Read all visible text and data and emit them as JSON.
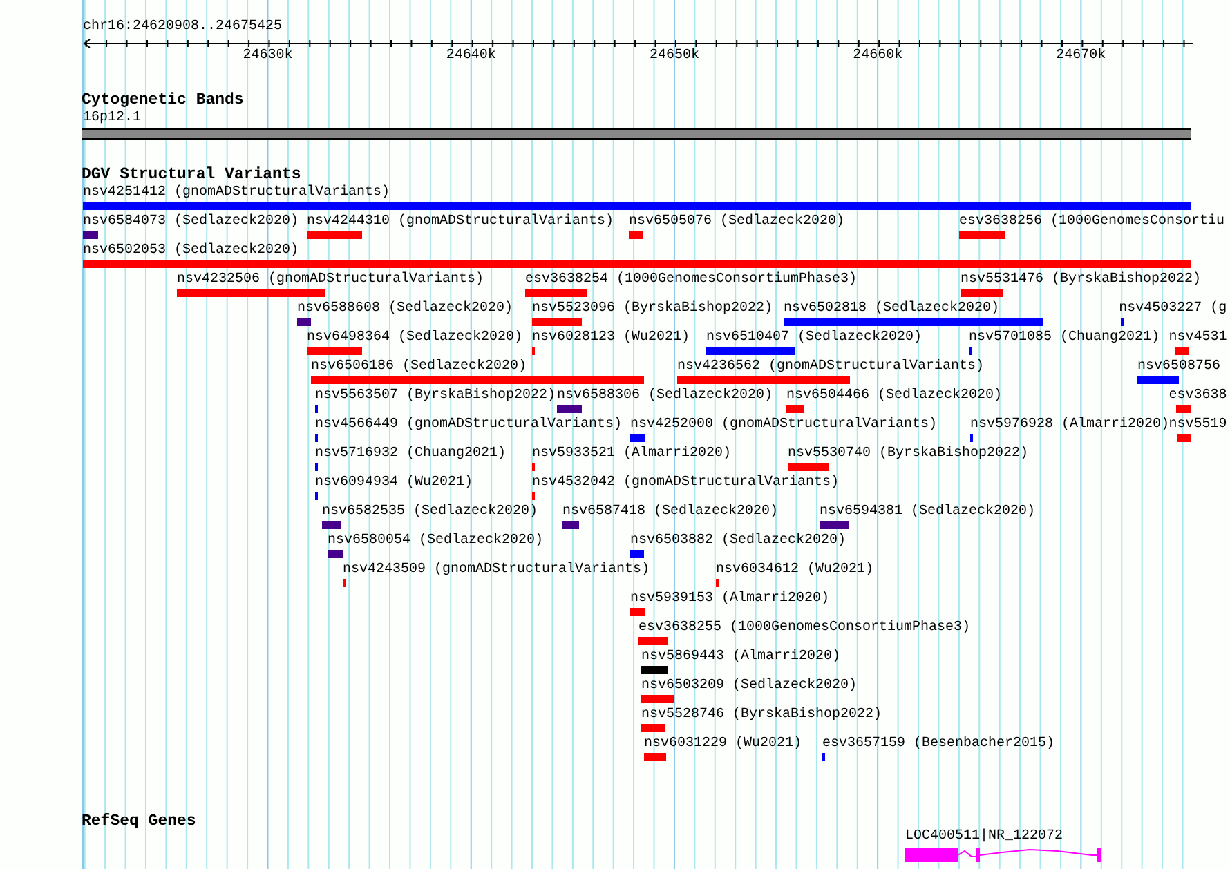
{
  "ruler": {
    "range": "chr16:24620908..24675425",
    "ticks": [
      "24630k",
      "24640k",
      "24650k",
      "24660k",
      "24670k"
    ]
  },
  "cytoband_track": {
    "title": "Cytogenetic Bands",
    "band": "16p12.1"
  },
  "dgv_track": {
    "title": "DGV Structural Variants",
    "rows": [
      {
        "features": [
          {
            "label": "nsv4251412 (gnomADStructuralVariants)",
            "color": "#0000ff"
          }
        ]
      },
      {
        "features": [
          {
            "label": "nsv6584073 (Sedlazeck2020)",
            "color": "#46008c"
          },
          {
            "label": "nsv4244310 (gnomADStructuralVariants)",
            "color": "#ff0000"
          },
          {
            "label": "nsv6505076 (Sedlazeck2020)",
            "color": "#ff0000"
          },
          {
            "label": "esv3638256 (1000GenomesConsortiu",
            "color": "#ff0000"
          }
        ]
      },
      {
        "features": [
          {
            "label": "nsv6502053 (Sedlazeck2020)",
            "color": "#ff0000"
          }
        ]
      },
      {
        "features": [
          {
            "label": "nsv4232506 (gnomADStructuralVariants)",
            "color": "#ff0000"
          },
          {
            "label": "esv3638254 (1000GenomesConsortiumPhase3)",
            "color": "#ff0000"
          },
          {
            "label": "nsv5531476 (ByrskaBishop2022)",
            "color": "#ff0000"
          }
        ]
      },
      {
        "features": [
          {
            "label": "nsv6588608 (Sedlazeck2020)",
            "color": "#46008c"
          },
          {
            "label": "nsv5523096 (ByrskaBishop2022)",
            "color": "#ff0000"
          },
          {
            "label": "nsv6502818 (Sedlazeck2020)",
            "color": "#0000ff"
          },
          {
            "label": "nsv4503227 (g",
            "color": "#0000ff"
          }
        ]
      },
      {
        "features": [
          {
            "label": "nsv6498364 (Sedlazeck2020)",
            "color": "#ff0000"
          },
          {
            "label": "nsv6028123 (Wu2021)",
            "color": "#ff0000"
          },
          {
            "label": "nsv6510407 (Sedlazeck2020)",
            "color": "#0000ff"
          },
          {
            "label": "nsv5701085 (Chuang2021)",
            "color": "#0000ff"
          },
          {
            "label": "nsv4531",
            "color": "#ff0000"
          }
        ]
      },
      {
        "features": [
          {
            "label": "nsv6506186 (Sedlazeck2020)",
            "color": "#ff0000"
          },
          {
            "label": "nsv4236562 (gnomADStructuralVariants)",
            "color": "#ff0000"
          },
          {
            "label": "nsv6508756",
            "color": "#0000ff"
          }
        ]
      },
      {
        "features": [
          {
            "label": "nsv5563507 (ByrskaBishop2022)",
            "color": "#0000ff"
          },
          {
            "label": "nsv6588306 (Sedlazeck2020)",
            "color": "#46008c"
          },
          {
            "label": "nsv6504466 (Sedlazeck2020)",
            "color": "#ff0000"
          },
          {
            "label": "esv3638",
            "color": "#ff0000"
          }
        ]
      },
      {
        "features": [
          {
            "label": "nsv4566449 (gnomADStructuralVariants)",
            "color": "#0000ff"
          },
          {
            "label": "nsv4252000 (gnomADStructuralVariants)",
            "color": "#0000ff"
          },
          {
            "label": "nsv5976928 (Almarri2020)",
            "color": "#0000ff"
          },
          {
            "label": "nsv5519",
            "color": "#ff0000"
          }
        ]
      },
      {
        "features": [
          {
            "label": "nsv5716932 (Chuang2021)",
            "color": "#0000ff"
          },
          {
            "label": "nsv5933521 (Almarri2020)",
            "color": "#ff0000"
          },
          {
            "label": "nsv5530740 (ByrskaBishop2022)",
            "color": "#ff0000"
          }
        ]
      },
      {
        "features": [
          {
            "label": "nsv6094934 (Wu2021)",
            "color": "#0000ff"
          },
          {
            "label": "nsv4532042 (gnomADStructuralVariants)",
            "color": "#ff0000"
          }
        ]
      },
      {
        "features": [
          {
            "label": "nsv6582535 (Sedlazeck2020)",
            "color": "#46008c"
          },
          {
            "label": "nsv6587418 (Sedlazeck2020)",
            "color": "#46008c"
          },
          {
            "label": "nsv6594381 (Sedlazeck2020)",
            "color": "#46008c"
          }
        ]
      },
      {
        "features": [
          {
            "label": "nsv6580054 (Sedlazeck2020)",
            "color": "#46008c"
          },
          {
            "label": "nsv6503882 (Sedlazeck2020)",
            "color": "#0000ff"
          }
        ]
      },
      {
        "features": [
          {
            "label": "nsv4243509 (gnomADStructuralVariants)",
            "color": "#ff0000"
          },
          {
            "label": "nsv6034612 (Wu2021)",
            "color": "#ff0000"
          }
        ]
      },
      {
        "features": [
          {
            "label": "nsv5939153 (Almarri2020)",
            "color": "#ff0000"
          }
        ]
      },
      {
        "features": [
          {
            "label": "esv3638255 (1000GenomesConsortiumPhase3)",
            "color": "#ff0000"
          }
        ]
      },
      {
        "features": [
          {
            "label": "nsv5869443 (Almarri2020)",
            "color": "#000000"
          }
        ]
      },
      {
        "features": [
          {
            "label": "nsv6503209 (Sedlazeck2020)",
            "color": "#ff0000"
          }
        ]
      },
      {
        "features": [
          {
            "label": "nsv5528746 (ByrskaBishop2022)",
            "color": "#ff0000"
          }
        ]
      },
      {
        "features": [
          {
            "label": "nsv6031229 (Wu2021)",
            "color": "#ff0000"
          },
          {
            "label": "esv3657159 (Besenbacher2015)",
            "color": "#0000ff"
          }
        ]
      }
    ]
  },
  "refseq_track": {
    "title": "RefSeq Genes",
    "genes": [
      {
        "label": "LOC400511|NR_122072"
      }
    ]
  }
}
